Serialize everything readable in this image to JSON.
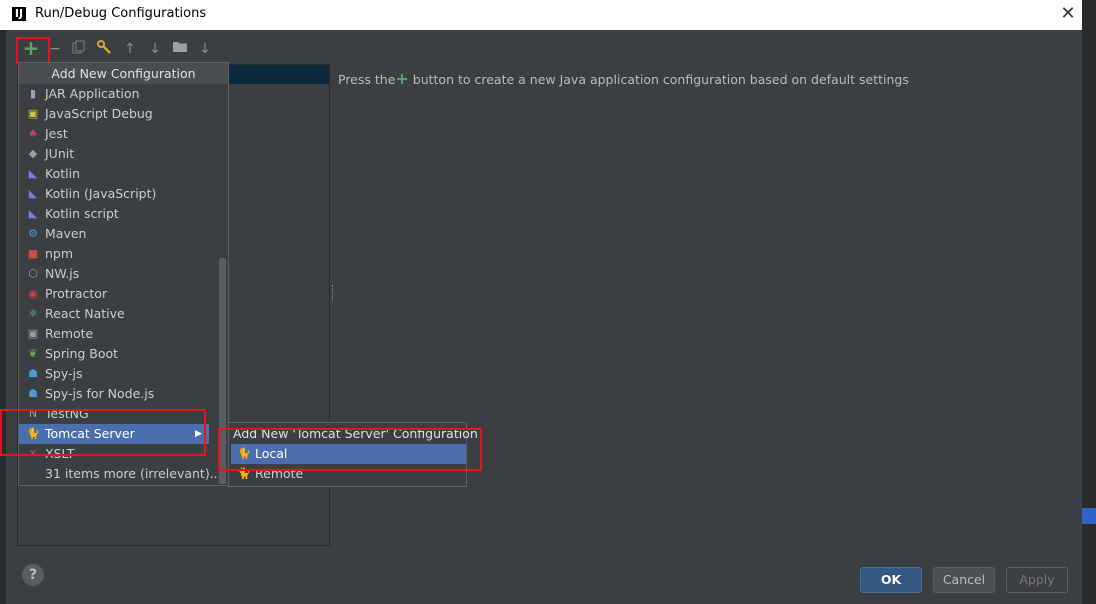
{
  "window": {
    "title": "Run/Debug Configurations",
    "app_icon": "IJ",
    "close": "✕"
  },
  "toolbar": {
    "add": "+",
    "remove": "−",
    "copy": "copy-icon",
    "edit_defaults": "wrench-icon",
    "move_up": "↑",
    "move_down": "↓",
    "folder": "folder-icon",
    "sort": "↓"
  },
  "info": {
    "prefix": "Press the",
    "plus": "+",
    "suffix": " button to create a new Java application configuration based on default settings"
  },
  "popup": {
    "header": "Add New Configuration",
    "items": [
      {
        "label": "JAR Application",
        "icon": "jar-icon",
        "icon_char": "▮",
        "icon_color": "#8aa4c4"
      },
      {
        "label": "JavaScript Debug",
        "icon": "js-debug-icon",
        "icon_char": "▣",
        "icon_color": "#d7c13a"
      },
      {
        "label": "Jest",
        "icon": "jest-icon",
        "icon_char": "♠",
        "icon_color": "#c2435e"
      },
      {
        "label": "JUnit",
        "icon": "junit-icon",
        "icon_char": "◆",
        "icon_color": "#9da0a3"
      },
      {
        "label": "Kotlin",
        "icon": "kotlin-icon",
        "icon_char": "◣",
        "icon_color": "#6f7be8"
      },
      {
        "label": "Kotlin (JavaScript)",
        "icon": "kotlin-js-icon",
        "icon_char": "◣",
        "icon_color": "#6f7be8"
      },
      {
        "label": "Kotlin script",
        "icon": "kotlin-script-icon",
        "icon_char": "◣",
        "icon_color": "#6f7be8"
      },
      {
        "label": "Maven",
        "icon": "maven-icon",
        "icon_char": "⚙",
        "icon_color": "#4a9bd6"
      },
      {
        "label": "npm",
        "icon": "npm-icon",
        "icon_char": "■",
        "icon_color": "#c84b3e"
      },
      {
        "label": "NW.js",
        "icon": "nwjs-icon",
        "icon_char": "⬡",
        "icon_color": "#8aa4c4"
      },
      {
        "label": "Protractor",
        "icon": "protractor-icon",
        "icon_char": "◉",
        "icon_color": "#d0443c"
      },
      {
        "label": "React Native",
        "icon": "react-icon",
        "icon_char": "⚛",
        "icon_color": "#5bc0de"
      },
      {
        "label": "Remote",
        "icon": "remote-icon",
        "icon_char": "▣",
        "icon_color": "#9da0a3"
      },
      {
        "label": "Spring Boot",
        "icon": "spring-boot-icon",
        "icon_char": "❦",
        "icon_color": "#6aad3d"
      },
      {
        "label": "Spy-js",
        "icon": "spyjs-icon",
        "icon_char": "☗",
        "icon_color": "#4a9bd6"
      },
      {
        "label": "Spy-js for Node.js",
        "icon": "spyjs-node-icon",
        "icon_char": "☗",
        "icon_color": "#4a9bd6"
      },
      {
        "label": "TestNG",
        "icon": "testng-icon",
        "icon_char": "N",
        "icon_color": "#9da0a3"
      },
      {
        "label": "Tomcat Server",
        "icon": "tomcat-icon",
        "icon_char": "🐈",
        "icon_color": "#d8b03a",
        "selected": true,
        "submenu_arrow": "▶"
      },
      {
        "label": "XSLT",
        "icon": "xslt-icon",
        "icon_char": "✕",
        "icon_color": "#c84b3e"
      },
      {
        "label": "31 items more (irrelevant)...",
        "icon": "",
        "icon_char": "",
        "icon_color": "#3c3f41"
      }
    ]
  },
  "submenu": {
    "header": "Add New 'Tomcat Server' Configuration",
    "items": [
      {
        "label": "Local",
        "icon": "tomcat-local-icon",
        "icon_char": "🐈",
        "selected": true
      },
      {
        "label": "Remote",
        "icon": "tomcat-remote-icon",
        "icon_char": "🐈"
      }
    ]
  },
  "buttons": {
    "help": "?",
    "ok": "OK",
    "cancel": "Cancel",
    "apply": "Apply"
  }
}
